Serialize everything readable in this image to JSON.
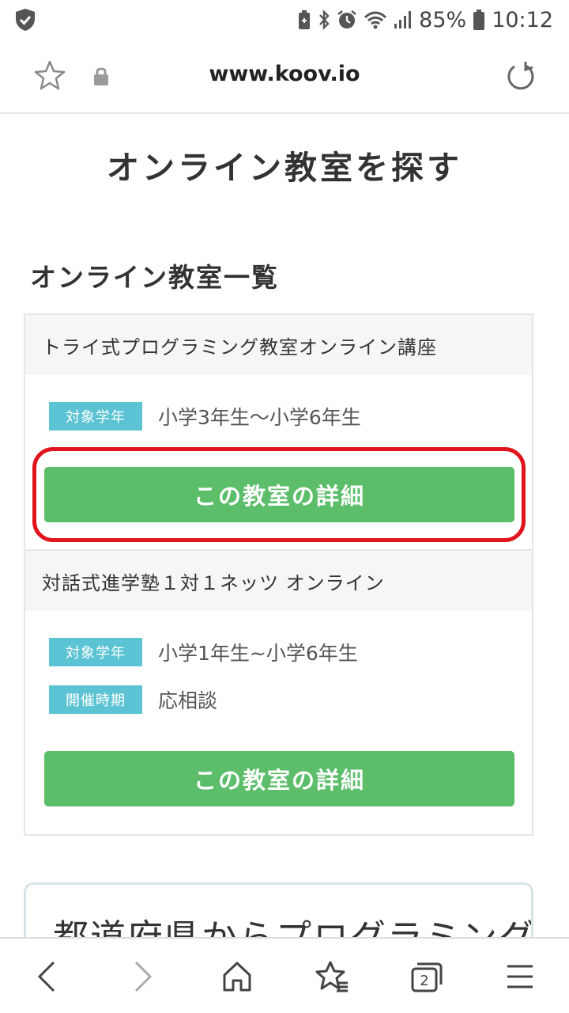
{
  "status_bar": {
    "battery_percent": "85%",
    "time": "10:12"
  },
  "url_bar": {
    "url": "www.koov.io"
  },
  "page": {
    "title": "オンライン教室を探す",
    "section_title": "オンライン教室一覧"
  },
  "classrooms": [
    {
      "name": "トライ式プログラミング教室オンライン講座",
      "rows": [
        {
          "tag": "対象学年",
          "value": "小学3年生〜小学6年生"
        }
      ],
      "button_label": "この教室の詳細"
    },
    {
      "name": "対話式進学塾１対１ネッツ オンライン",
      "rows": [
        {
          "tag": "対象学年",
          "value": "小学1年生~小学6年生"
        },
        {
          "tag": "開催時期",
          "value": "応相談"
        }
      ],
      "button_label": "この教室の詳細"
    }
  ],
  "prefecture_section": {
    "title": "都道府県からプログラミング"
  },
  "colors": {
    "tag_bg": "#5bc3d3",
    "button_bg": "#5cbd6a",
    "highlight": "#e0141c"
  }
}
